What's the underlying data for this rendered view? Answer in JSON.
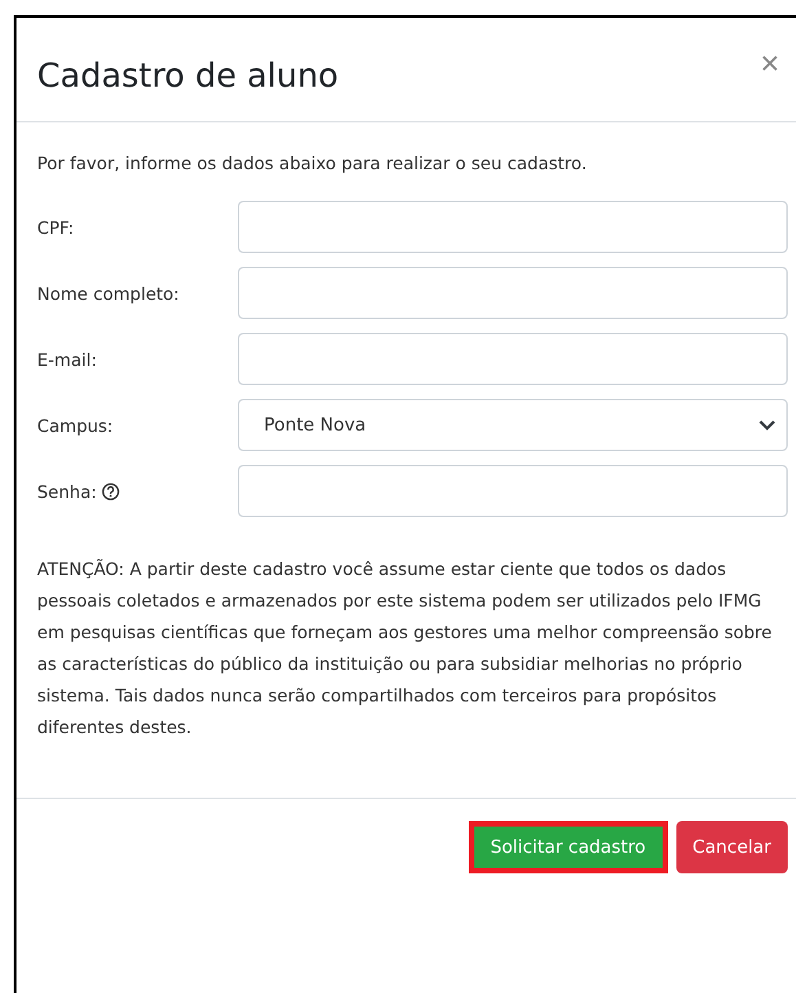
{
  "modal": {
    "title": "Cadastro de aluno",
    "close": "×"
  },
  "intro": "Por favor, informe os dados abaixo para realizar o seu cadastro.",
  "fields": [
    {
      "label": "CPF:",
      "kind": "input",
      "help": false
    },
    {
      "label": "Nome completo:",
      "kind": "input",
      "help": false
    },
    {
      "label": "E-mail:",
      "kind": "input",
      "help": false
    },
    {
      "label": "Campus:",
      "kind": "select",
      "value": "Ponte Nova",
      "help": false
    },
    {
      "label": "Senha:",
      "kind": "input",
      "help": true
    }
  ],
  "notice": "ATENÇÃO: A partir deste cadastro você assume estar ciente que todos os dados pessoais coletados e armazenados por este sistema podem ser utilizados pelo IFMG em pesquisas científicas que forneçam aos gestores uma melhor compreensão sobre as características do público da instituição ou para subsidiar melhorias no próprio sistema. Tais dados nunca serão compartilhados com terceiros para propósitos diferentes destes.",
  "buttons": [
    {
      "label": "Solicitar cadastro",
      "kind": "success",
      "highlighted": true
    },
    {
      "label": "Cancelar",
      "kind": "danger",
      "highlighted": false
    }
  ]
}
